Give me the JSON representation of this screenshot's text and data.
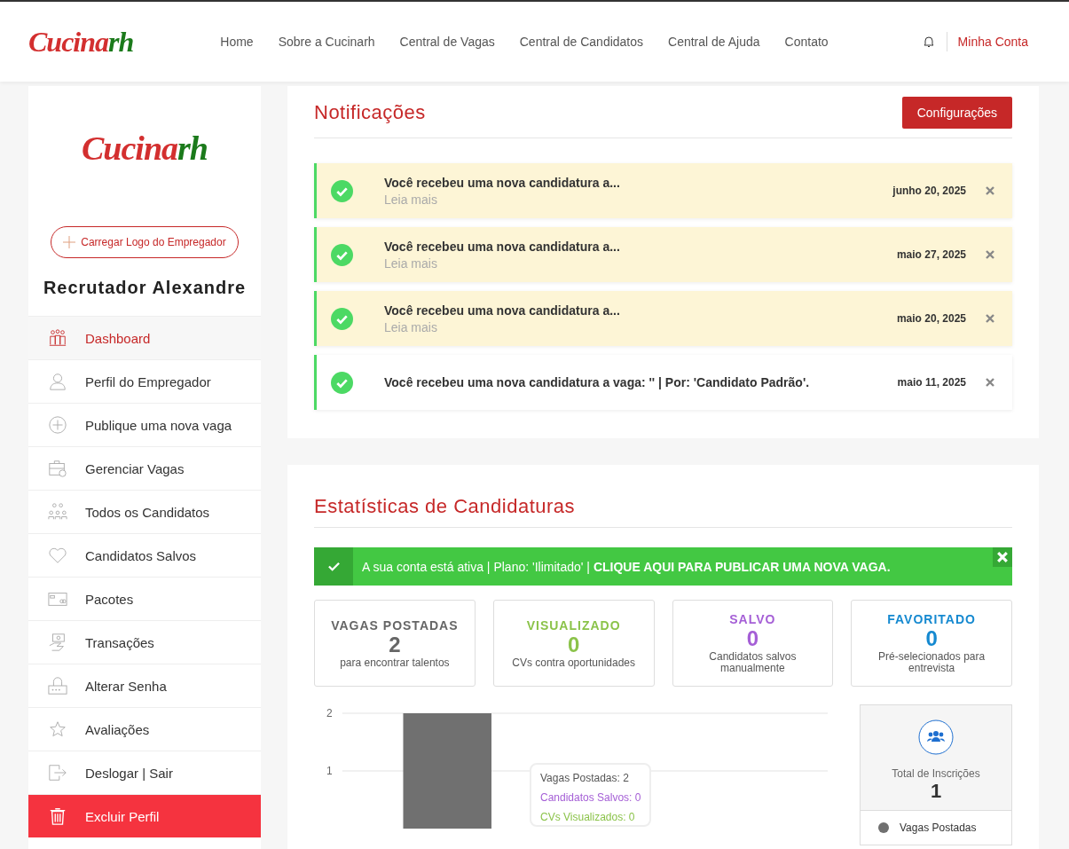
{
  "header": {
    "logo": {
      "text": "Cucina",
      "suffix": "rh"
    },
    "nav": [
      "Home",
      "Sobre a Cucinarh",
      "Central de Vagas",
      "Central de Candidatos",
      "Central de Ajuda",
      "Contato"
    ],
    "account": "Minha Conta"
  },
  "sidebar": {
    "logo": {
      "text": "Cucina",
      "suffix": "rh"
    },
    "upload_button": "Carregar Logo do Empregador",
    "name": "Recrutador Alexandre",
    "items": [
      {
        "label": "Dashboard",
        "kind": "dashboard",
        "selected": true
      },
      {
        "label": "Perfil do Empregador",
        "kind": "profile",
        "selected": false
      },
      {
        "label": "Publique uma nova vaga",
        "kind": "plus",
        "selected": false
      },
      {
        "label": "Gerenciar Vagas",
        "kind": "briefcase",
        "selected": false
      },
      {
        "label": "Todos os Candidatos",
        "kind": "people",
        "selected": false
      },
      {
        "label": "Candidatos Salvos",
        "kind": "heart",
        "selected": false
      },
      {
        "label": "Pacotes",
        "kind": "card",
        "selected": false
      },
      {
        "label": "Transações",
        "kind": "money",
        "selected": false
      },
      {
        "label": "Alterar Senha",
        "kind": "lock",
        "selected": false
      },
      {
        "label": "Avaliações",
        "kind": "star",
        "selected": false
      },
      {
        "label": "Deslogar | Sair",
        "kind": "logout",
        "selected": false
      },
      {
        "label": "Excluir Perfil",
        "kind": "delete",
        "selected": false
      }
    ]
  },
  "notifications": {
    "title": "Notificações",
    "settings_button": "Configurações",
    "items": [
      {
        "text": "Você recebeu uma nova candidatura a...",
        "link": "Leia mais",
        "date": "junho 20, 2025",
        "unread": true
      },
      {
        "text": "Você recebeu uma nova candidatura a...",
        "link": "Leia mais",
        "date": "maio 27, 2025",
        "unread": true
      },
      {
        "text": "Você recebeu uma nova candidatura a...",
        "link": "Leia mais",
        "date": "maio 20, 2025",
        "unread": true
      },
      {
        "text": "Você recebeu uma nova candidatura a vaga: '' | Por: 'Candidato Padrão'.",
        "date": "maio 11, 2025",
        "unread": false
      }
    ]
  },
  "statistics": {
    "title": "Estatísticas de Candidaturas",
    "alert": "A sua conta está ativa | Plano: 'Ilimitado' | **CLIQUE AQUI PARA PUBLICAR UMA NOVA VAGA.**",
    "boxes": [
      {
        "label": "VAGAS POSTADAS",
        "value": "2",
        "caption": "para encontrar talentos",
        "color": "#666666"
      },
      {
        "label": "VISUALIZADO",
        "value": "0",
        "caption": "CVs contra oportunidades",
        "color": "#8bc34a"
      },
      {
        "label": "SALVO",
        "value": "0",
        "caption": "Candidatos salvos manualmente",
        "color": "#a55fd6"
      },
      {
        "label": "FAVORITADO",
        "value": "0",
        "caption": "Pré-selecionados para entrevista",
        "color": "#1589d0"
      }
    ],
    "chart_data": {
      "type": "bar",
      "ylim": [
        0,
        2
      ],
      "yticks": [
        1,
        2
      ],
      "series": [
        {
          "name": "Vagas Postadas",
          "color": "#707070",
          "values": [
            2
          ]
        }
      ]
    },
    "tooltip": [
      {
        "text": "Vagas Postadas: 2",
        "color": "#555555"
      },
      {
        "text": "Candidatos Salvos: 0",
        "color": "#a55fd6"
      },
      {
        "text": "CVs Visualizados: 0",
        "color": "#8bc34a"
      }
    ],
    "total": {
      "label": "Total de Inscrições",
      "value": "1"
    }
  }
}
